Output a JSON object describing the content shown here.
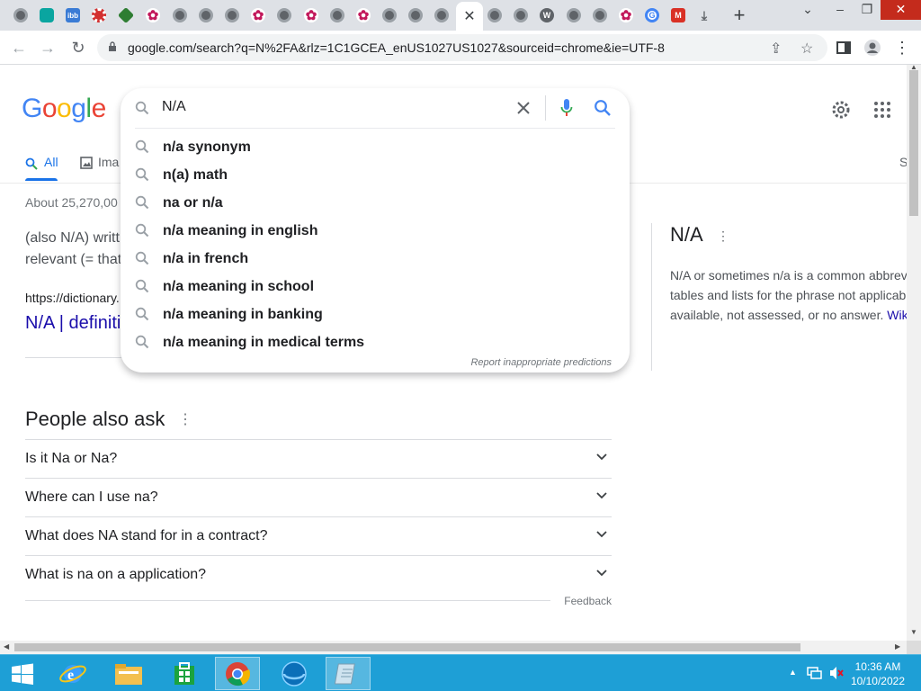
{
  "browser": {
    "active_tab_close": "✕",
    "new_tab": "+",
    "url": "google.com/search?q=N%2FA&rlz=1C1GCEA_enUS1027US1027&sourceid=chrome&ie=UTF-8",
    "tab_favicons": [
      "globe",
      "edge",
      "ibb",
      "mushroom",
      "app",
      "flower",
      "globe",
      "globe",
      "globe",
      "flower",
      "globe",
      "flower",
      "globe",
      "flower",
      "globe",
      "globe",
      "globe",
      "active",
      "globe",
      "globe",
      "wordpress",
      "globe",
      "globe",
      "flower",
      "google",
      "gmail",
      "download"
    ],
    "fav_label_ibb": "ibb",
    "fav_label_wp": "W",
    "fav_label_g": "G",
    "fav_label_m": "M"
  },
  "google": {
    "logo": [
      "G",
      "o",
      "o",
      "g",
      "l",
      "e"
    ],
    "logo_colors": [
      "#4285f4",
      "#ea4335",
      "#fbbc05",
      "#4285f4",
      "#34a853",
      "#ea4335"
    ],
    "query": "N/A",
    "suggestions": [
      "n/a synonym",
      "n(a) math",
      "na or n/a",
      "n/a meaning in english",
      "n/a in french",
      "n/a meaning in school",
      "n/a meaning in banking",
      "n/a meaning in medical terms"
    ],
    "report": "Report inappropriate predictions",
    "tabs": {
      "all": "All",
      "images": "Ima",
      "right": "S"
    },
    "stats": "About 25,270,00",
    "snippet_line1": "(also N/A) writt",
    "snippet_line2": "relevant (= that",
    "cite": "https://dictionary.",
    "result_title": "N/A | definiti",
    "paa_title": "People also ask",
    "paa": [
      "Is it Na or Na?",
      "Where can I use na?",
      "What does NA stand for in a contract?",
      "What is na on a application?"
    ],
    "feedback": "Feedback",
    "kp_title": "N/A",
    "kp_desc1": "N/A or sometimes n/a is a common abbrev",
    "kp_desc2": "tables and lists for the phrase not applicab",
    "kp_desc3": "available, not assessed, or no answer.",
    "kp_more": "Wik"
  },
  "taskbar": {
    "time": "10:36 AM",
    "date": "10/10/2022"
  },
  "colors": {
    "accent": "#1a73e8",
    "link": "#1a0dab",
    "taskbar": "#1e9fd6"
  }
}
